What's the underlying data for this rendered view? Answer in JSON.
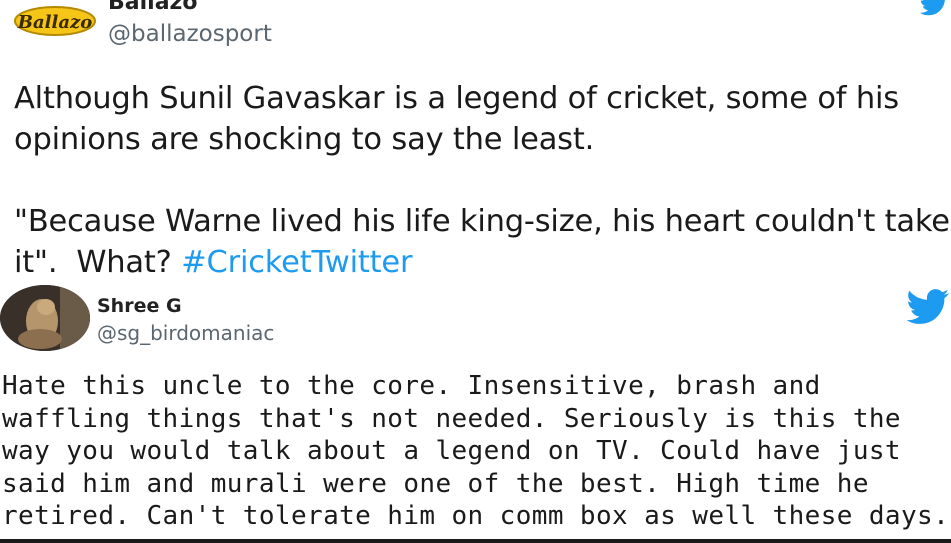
{
  "tweet1": {
    "author_name": "Ballazo",
    "handle": "@ballazosport",
    "logo_text": "Ballazo",
    "text_part1": "Although Sunil Gavaskar is a legend of cricket, some of his opinions are shocking to say the least.\n\n\"Because Warne lived his life king-size, his heart couldn't take it\".  What? ",
    "hashtag": "#CricketTwitter"
  },
  "tweet2": {
    "author_name": "Shree G",
    "handle": "@sg_birdomaniac",
    "text": "Hate this uncle to the core. Insensitive, brash and waffling things that's not needed. Seriously is this the way you would talk about a legend on TV. Could have just said him and murali were one of the best. High time he retired. Can't tolerate him on comm box as well these days."
  },
  "icons": {
    "brand": "twitter-bird-icon",
    "brand_color": "#1d9bf0"
  }
}
